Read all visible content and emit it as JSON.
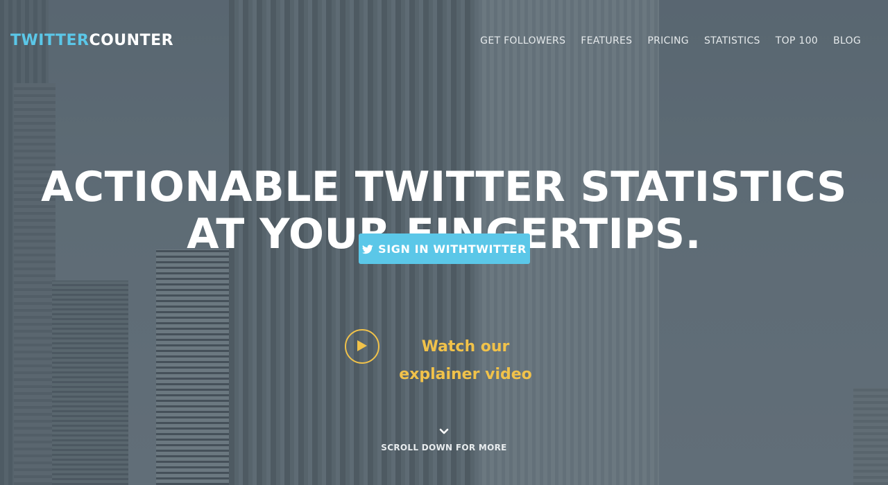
{
  "header": {
    "logo": {
      "part1": "TWITTER",
      "part2": "COUNTER"
    },
    "nav": [
      {
        "label": "GET FOLLOWERS"
      },
      {
        "label": "FEATURES"
      },
      {
        "label": "PRICING"
      },
      {
        "label": "STATISTICS"
      },
      {
        "label": "TOP 100"
      },
      {
        "label": "BLOG"
      }
    ]
  },
  "hero": {
    "headline_line1": "ACTIONABLE TWITTER STATISTICS",
    "headline_line2": "AT YOUR FINGERTIPS.",
    "signin_label": "SIGN IN WITHTWITTER",
    "video_label": "Watch our explainer video",
    "scroll_label": "SCROLL DOWN FOR MORE"
  },
  "icons": {
    "signin": "twitter-bird-icon",
    "video": "play-icon",
    "scroll": "chevron-down-icon"
  },
  "colors": {
    "brand_blue": "#5bc7e8",
    "accent_yellow": "#f1c24a",
    "text_white": "#ffffff"
  }
}
